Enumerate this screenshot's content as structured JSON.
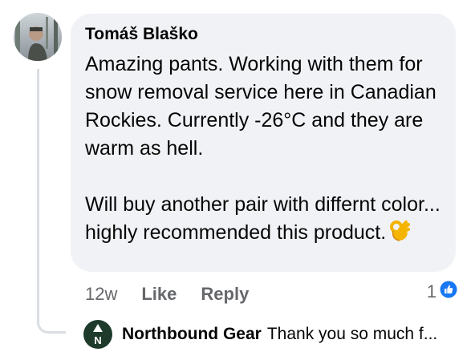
{
  "comment": {
    "author": "Tomáš Blaško",
    "text": "Amazing pants. Working with them for snow removal service here in Canadian Rockies. Currently -26°C and they are warm as hell.\n\nWill buy another pair with differnt color... highly recommended this product.",
    "emoji_icon": "ok-hand-emoji-icon"
  },
  "actions": {
    "time": "12w",
    "like_label": "Like",
    "reply_label": "Reply"
  },
  "reactions": {
    "count": "1",
    "icon": "like-reaction-icon",
    "color": "#1877f2"
  },
  "reply": {
    "author": "Northbound Gear",
    "text_preview": "Thank you so much f...",
    "avatar_icon": "northbound-logo-icon",
    "avatar_color": "#1d3a2b"
  }
}
